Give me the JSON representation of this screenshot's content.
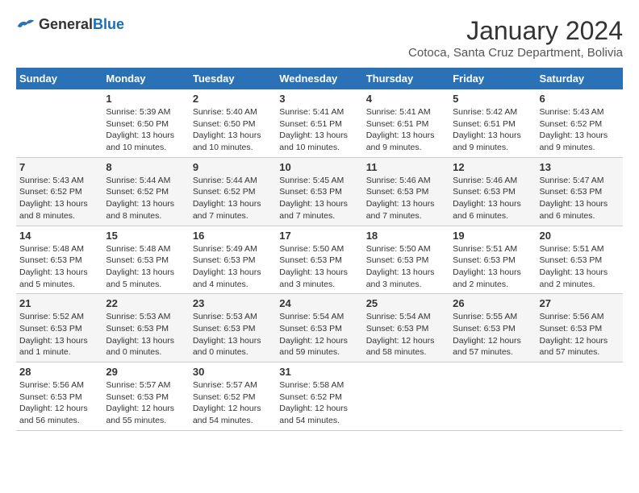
{
  "header": {
    "logo_general": "General",
    "logo_blue": "Blue",
    "month_title": "January 2024",
    "location": "Cotoca, Santa Cruz Department, Bolivia"
  },
  "days_of_week": [
    "Sunday",
    "Monday",
    "Tuesday",
    "Wednesday",
    "Thursday",
    "Friday",
    "Saturday"
  ],
  "weeks": [
    [
      {
        "day": "",
        "info": ""
      },
      {
        "day": "1",
        "info": "Sunrise: 5:39 AM\nSunset: 6:50 PM\nDaylight: 13 hours\nand 10 minutes."
      },
      {
        "day": "2",
        "info": "Sunrise: 5:40 AM\nSunset: 6:50 PM\nDaylight: 13 hours\nand 10 minutes."
      },
      {
        "day": "3",
        "info": "Sunrise: 5:41 AM\nSunset: 6:51 PM\nDaylight: 13 hours\nand 10 minutes."
      },
      {
        "day": "4",
        "info": "Sunrise: 5:41 AM\nSunset: 6:51 PM\nDaylight: 13 hours\nand 9 minutes."
      },
      {
        "day": "5",
        "info": "Sunrise: 5:42 AM\nSunset: 6:51 PM\nDaylight: 13 hours\nand 9 minutes."
      },
      {
        "day": "6",
        "info": "Sunrise: 5:43 AM\nSunset: 6:52 PM\nDaylight: 13 hours\nand 9 minutes."
      }
    ],
    [
      {
        "day": "7",
        "info": "Sunrise: 5:43 AM\nSunset: 6:52 PM\nDaylight: 13 hours\nand 8 minutes."
      },
      {
        "day": "8",
        "info": "Sunrise: 5:44 AM\nSunset: 6:52 PM\nDaylight: 13 hours\nand 8 minutes."
      },
      {
        "day": "9",
        "info": "Sunrise: 5:44 AM\nSunset: 6:52 PM\nDaylight: 13 hours\nand 7 minutes."
      },
      {
        "day": "10",
        "info": "Sunrise: 5:45 AM\nSunset: 6:53 PM\nDaylight: 13 hours\nand 7 minutes."
      },
      {
        "day": "11",
        "info": "Sunrise: 5:46 AM\nSunset: 6:53 PM\nDaylight: 13 hours\nand 7 minutes."
      },
      {
        "day": "12",
        "info": "Sunrise: 5:46 AM\nSunset: 6:53 PM\nDaylight: 13 hours\nand 6 minutes."
      },
      {
        "day": "13",
        "info": "Sunrise: 5:47 AM\nSunset: 6:53 PM\nDaylight: 13 hours\nand 6 minutes."
      }
    ],
    [
      {
        "day": "14",
        "info": "Sunrise: 5:48 AM\nSunset: 6:53 PM\nDaylight: 13 hours\nand 5 minutes."
      },
      {
        "day": "15",
        "info": "Sunrise: 5:48 AM\nSunset: 6:53 PM\nDaylight: 13 hours\nand 5 minutes."
      },
      {
        "day": "16",
        "info": "Sunrise: 5:49 AM\nSunset: 6:53 PM\nDaylight: 13 hours\nand 4 minutes."
      },
      {
        "day": "17",
        "info": "Sunrise: 5:50 AM\nSunset: 6:53 PM\nDaylight: 13 hours\nand 3 minutes."
      },
      {
        "day": "18",
        "info": "Sunrise: 5:50 AM\nSunset: 6:53 PM\nDaylight: 13 hours\nand 3 minutes."
      },
      {
        "day": "19",
        "info": "Sunrise: 5:51 AM\nSunset: 6:53 PM\nDaylight: 13 hours\nand 2 minutes."
      },
      {
        "day": "20",
        "info": "Sunrise: 5:51 AM\nSunset: 6:53 PM\nDaylight: 13 hours\nand 2 minutes."
      }
    ],
    [
      {
        "day": "21",
        "info": "Sunrise: 5:52 AM\nSunset: 6:53 PM\nDaylight: 13 hours\nand 1 minute."
      },
      {
        "day": "22",
        "info": "Sunrise: 5:53 AM\nSunset: 6:53 PM\nDaylight: 13 hours\nand 0 minutes."
      },
      {
        "day": "23",
        "info": "Sunrise: 5:53 AM\nSunset: 6:53 PM\nDaylight: 13 hours\nand 0 minutes."
      },
      {
        "day": "24",
        "info": "Sunrise: 5:54 AM\nSunset: 6:53 PM\nDaylight: 12 hours\nand 59 minutes."
      },
      {
        "day": "25",
        "info": "Sunrise: 5:54 AM\nSunset: 6:53 PM\nDaylight: 12 hours\nand 58 minutes."
      },
      {
        "day": "26",
        "info": "Sunrise: 5:55 AM\nSunset: 6:53 PM\nDaylight: 12 hours\nand 57 minutes."
      },
      {
        "day": "27",
        "info": "Sunrise: 5:56 AM\nSunset: 6:53 PM\nDaylight: 12 hours\nand 57 minutes."
      }
    ],
    [
      {
        "day": "28",
        "info": "Sunrise: 5:56 AM\nSunset: 6:53 PM\nDaylight: 12 hours\nand 56 minutes."
      },
      {
        "day": "29",
        "info": "Sunrise: 5:57 AM\nSunset: 6:53 PM\nDaylight: 12 hours\nand 55 minutes."
      },
      {
        "day": "30",
        "info": "Sunrise: 5:57 AM\nSunset: 6:52 PM\nDaylight: 12 hours\nand 54 minutes."
      },
      {
        "day": "31",
        "info": "Sunrise: 5:58 AM\nSunset: 6:52 PM\nDaylight: 12 hours\nand 54 minutes."
      },
      {
        "day": "",
        "info": ""
      },
      {
        "day": "",
        "info": ""
      },
      {
        "day": "",
        "info": ""
      }
    ]
  ]
}
